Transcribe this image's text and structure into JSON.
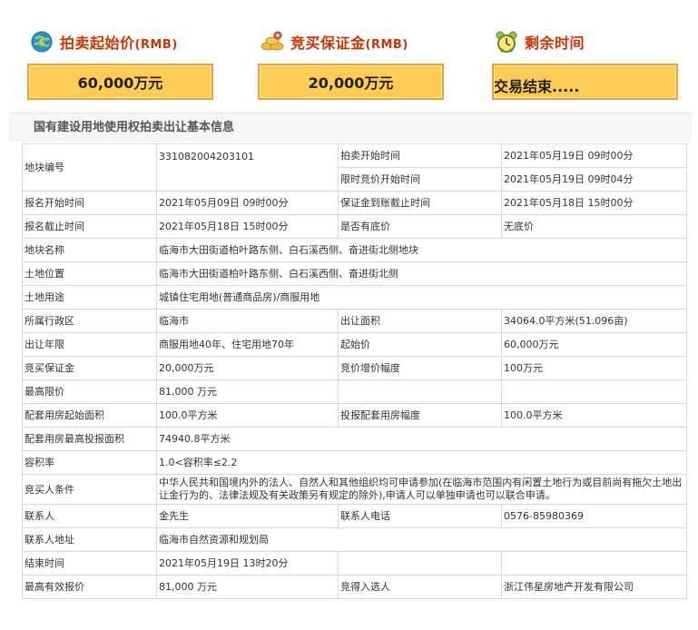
{
  "header": {
    "start_price": {
      "label": "拍卖起始价",
      "unit": "(RMB)",
      "value": "60,000万元"
    },
    "deposit": {
      "label": "竞买保证金",
      "unit": "(RMB)",
      "value": "20,000万元"
    },
    "remaining": {
      "label": "剩余时间",
      "value": "交易结束....."
    }
  },
  "section_title": "国有建设用地使用权拍卖出让基本信息",
  "rows": {
    "parcel_no": {
      "label": "地块编号",
      "value": "331082004203101"
    },
    "auction_start": {
      "label": "拍卖开始时间",
      "value": "2021年05月19日 09时00分"
    },
    "timed_start": {
      "label": "限时竞价开始时间",
      "value": "2021年05月19日 09时04分"
    },
    "reg_start": {
      "label": "报名开始时间",
      "value": "2021年05月09日 09时00分"
    },
    "deposit_deadline": {
      "label": "保证金到账截止时间",
      "value": "2021年05月18日 15时00分"
    },
    "reg_end": {
      "label": "报名截止时间",
      "value": "2021年05月18日 15时00分"
    },
    "reserve": {
      "label": "是否有底价",
      "value": "无底价"
    },
    "parcel_name": {
      "label": "地块名称",
      "value": "临海市大田街道柏叶路东侧、白石溪西侧、奋进街北侧地块"
    },
    "location": {
      "label": "土地位置",
      "value": "临海市大田街道柏叶路东侧、白石溪西侧、奋进街北侧"
    },
    "usage": {
      "label": "土地用途",
      "value": "城镇住宅用地(普通商品房)/商服用地"
    },
    "district": {
      "label": "所属行政区",
      "value": "临海市"
    },
    "area": {
      "label": "出让面积",
      "value": "34064.0平方米(51.096亩)"
    },
    "term": {
      "label": "出让年限",
      "value": "商服用地40年、住宅用地70年"
    },
    "start_price": {
      "label": "起始价",
      "value": "60,000万元"
    },
    "deposit": {
      "label": "竞买保证金",
      "value": "20,000万元"
    },
    "increment": {
      "label": "竞价增价幅度",
      "value": "100万元"
    },
    "max_price": {
      "label": "最高限价",
      "value": "81,000 万元"
    },
    "housing_start": {
      "label": "配套用房起始面积",
      "value": "100.0平方米"
    },
    "housing_step": {
      "label": "投报配套用房幅度",
      "value": "100.0平方米"
    },
    "housing_max": {
      "label": "配套用房最高投报面积",
      "value": "74940.8平方米"
    },
    "far": {
      "label": "容积率",
      "value": "1.0<容积率≤2.2"
    },
    "requirements": {
      "label": "竞买人条件",
      "value": "中华人民共和国境内外的法人、自然人和其他组织均可申请参加(在临海市范围内有闲置土地行为或目前尚有拖欠土地出让金行为的、法律法规及有关政策另有规定的除外),申请人可以单独申请也可以联合申请。"
    },
    "contact": {
      "label": "联系人",
      "value": "金先生"
    },
    "phone": {
      "label": "联系人电话",
      "value": "0576-85980369"
    },
    "address": {
      "label": "联系人地址",
      "value": "临海市自然资源和规划局"
    },
    "end_time": {
      "label": "结束时间",
      "value": "2021年05月19日 13时20分"
    },
    "best_bid": {
      "label": "最高有效报价",
      "value": "81,000 万元"
    },
    "winner": {
      "label": "竞得入选人",
      "value": "浙江伟星房地产开发有限公司"
    }
  },
  "colors": {
    "accent_text": "#cc3300",
    "box_fill": "#ffcc55",
    "box_border": "#e8a040"
  },
  "icons": [
    "money-globe-icon",
    "coins-icon",
    "alarm-clock-icon"
  ]
}
